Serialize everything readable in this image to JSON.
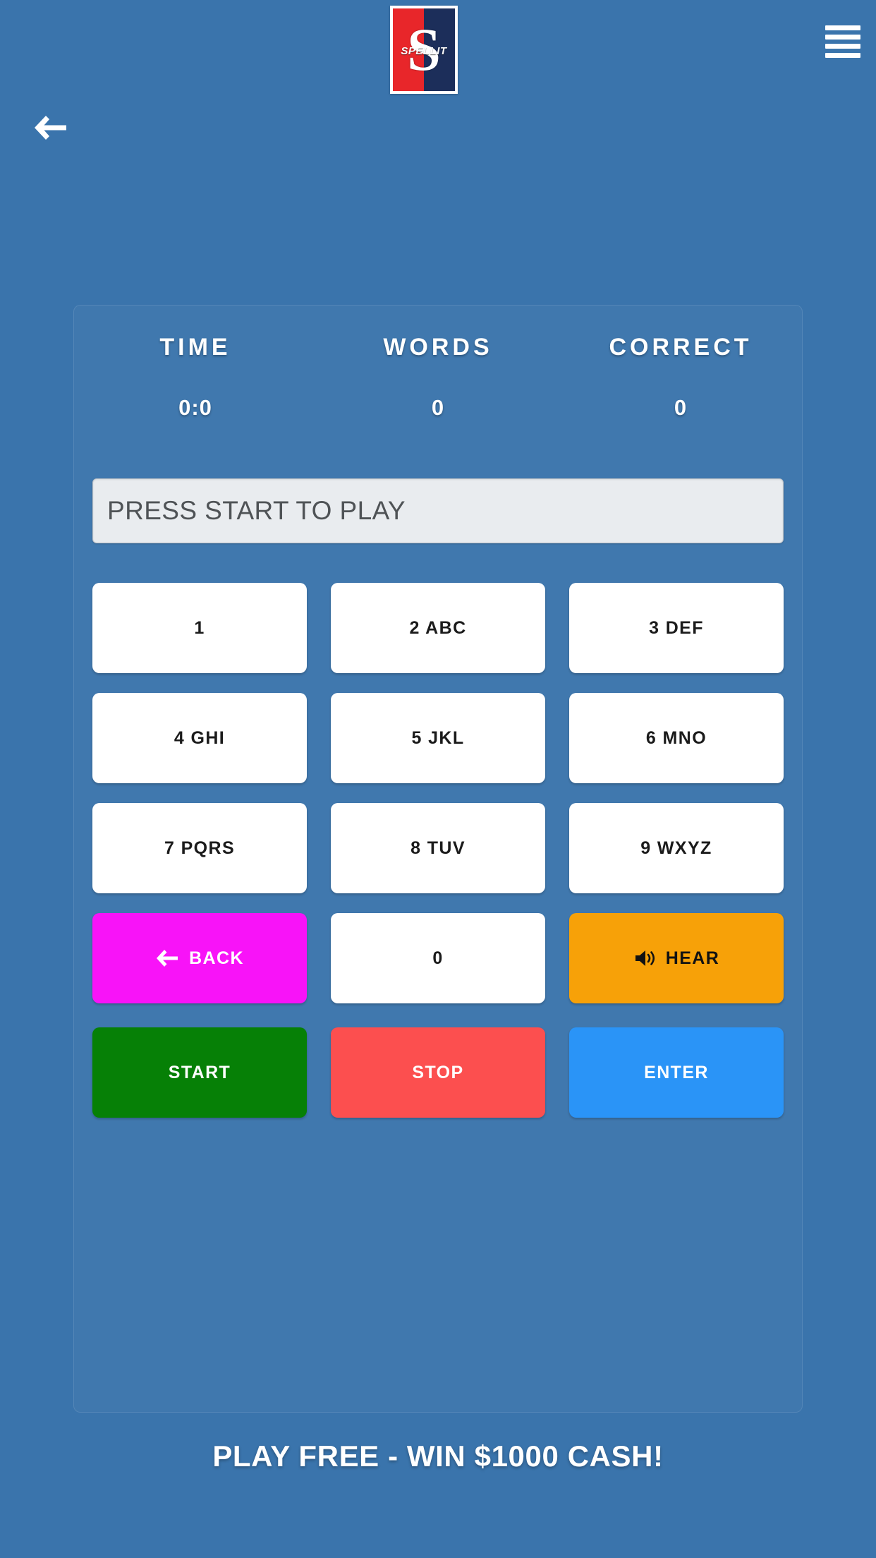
{
  "app": {
    "background_color": "#3a74ac",
    "logo": {
      "brand_letter": "S",
      "brand_word": "SPELLIT",
      "left_color": "#e8262a",
      "right_color": "#1c2e5a"
    }
  },
  "header": {
    "menu_icon": "hamburger-menu-icon",
    "back_icon": "arrow-left-icon"
  },
  "scoreboard": {
    "columns": [
      {
        "label": "TIME",
        "value": "0:0"
      },
      {
        "label": "WORDS",
        "value": "0"
      },
      {
        "label": "CORRECT",
        "value": "0"
      }
    ]
  },
  "display": {
    "value": "PRESS START TO PLAY",
    "placeholder": "PRESS START TO PLAY"
  },
  "keypad": {
    "rows": [
      [
        {
          "label": "1",
          "name": "key-1"
        },
        {
          "label": "2 ABC",
          "name": "key-2"
        },
        {
          "label": "3 DEF",
          "name": "key-3"
        }
      ],
      [
        {
          "label": "4 GHI",
          "name": "key-4"
        },
        {
          "label": "5 JKL",
          "name": "key-5"
        },
        {
          "label": "6 MNO",
          "name": "key-6"
        }
      ],
      [
        {
          "label": "7 PQRS",
          "name": "key-7"
        },
        {
          "label": "8 TUV",
          "name": "key-8"
        },
        {
          "label": "9 WXYZ",
          "name": "key-9"
        }
      ]
    ],
    "utility_row": {
      "back": {
        "label": "BACK",
        "icon": "arrow-left-icon",
        "color": "#f813f8",
        "text_color": "#ffffff"
      },
      "zero": {
        "label": "0",
        "color": "#ffffff",
        "text_color": "#1b1b1b"
      },
      "hear": {
        "label": "HEAR",
        "icon": "speaker-volume-icon",
        "color": "#f7a108",
        "text_color": "#121212"
      }
    },
    "action_row": {
      "start": {
        "label": "START",
        "color": "#068006",
        "text_color": "#ffffff"
      },
      "stop": {
        "label": "STOP",
        "color": "#fc4f4f",
        "text_color": "#ffffff"
      },
      "enter": {
        "label": "ENTER",
        "color": "#2a94f7",
        "text_color": "#ffffff"
      }
    }
  },
  "footer": {
    "promo_text": "PLAY FREE - WIN $1000 CASH!"
  }
}
